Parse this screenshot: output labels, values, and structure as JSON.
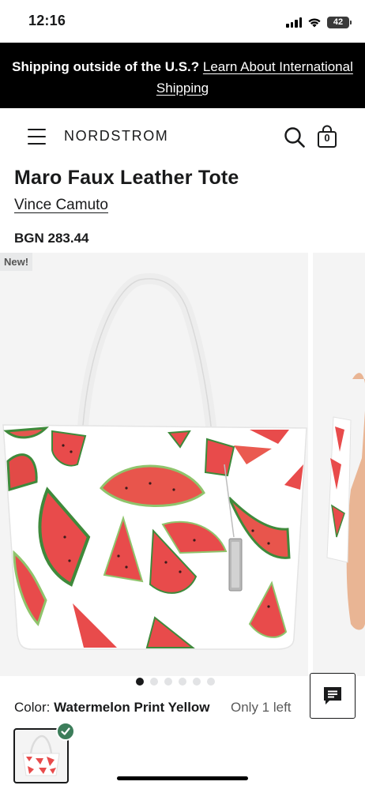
{
  "status_bar": {
    "time": "12:16",
    "battery": "42"
  },
  "banner": {
    "lead": "Shipping outside of the U.S.?",
    "link": "Learn About International Shipping"
  },
  "header": {
    "logo": "NORDSTROM",
    "bag_count": "0"
  },
  "product": {
    "title": "Maro Faux Leather Tote",
    "brand": "Vince Camuto",
    "price": "BGN 283.44",
    "badge": "New!"
  },
  "gallery": {
    "image_count": 6,
    "active_index": 0
  },
  "color": {
    "label": "Color:",
    "value": "Watermelon Print Yellow",
    "stock": "Only 1 left"
  },
  "colors": {
    "banner_bg": "#000000",
    "swatch_check": "#3c7d5a",
    "watermelon_red": "#e84b4b",
    "rind_green": "#3e8a3b"
  }
}
